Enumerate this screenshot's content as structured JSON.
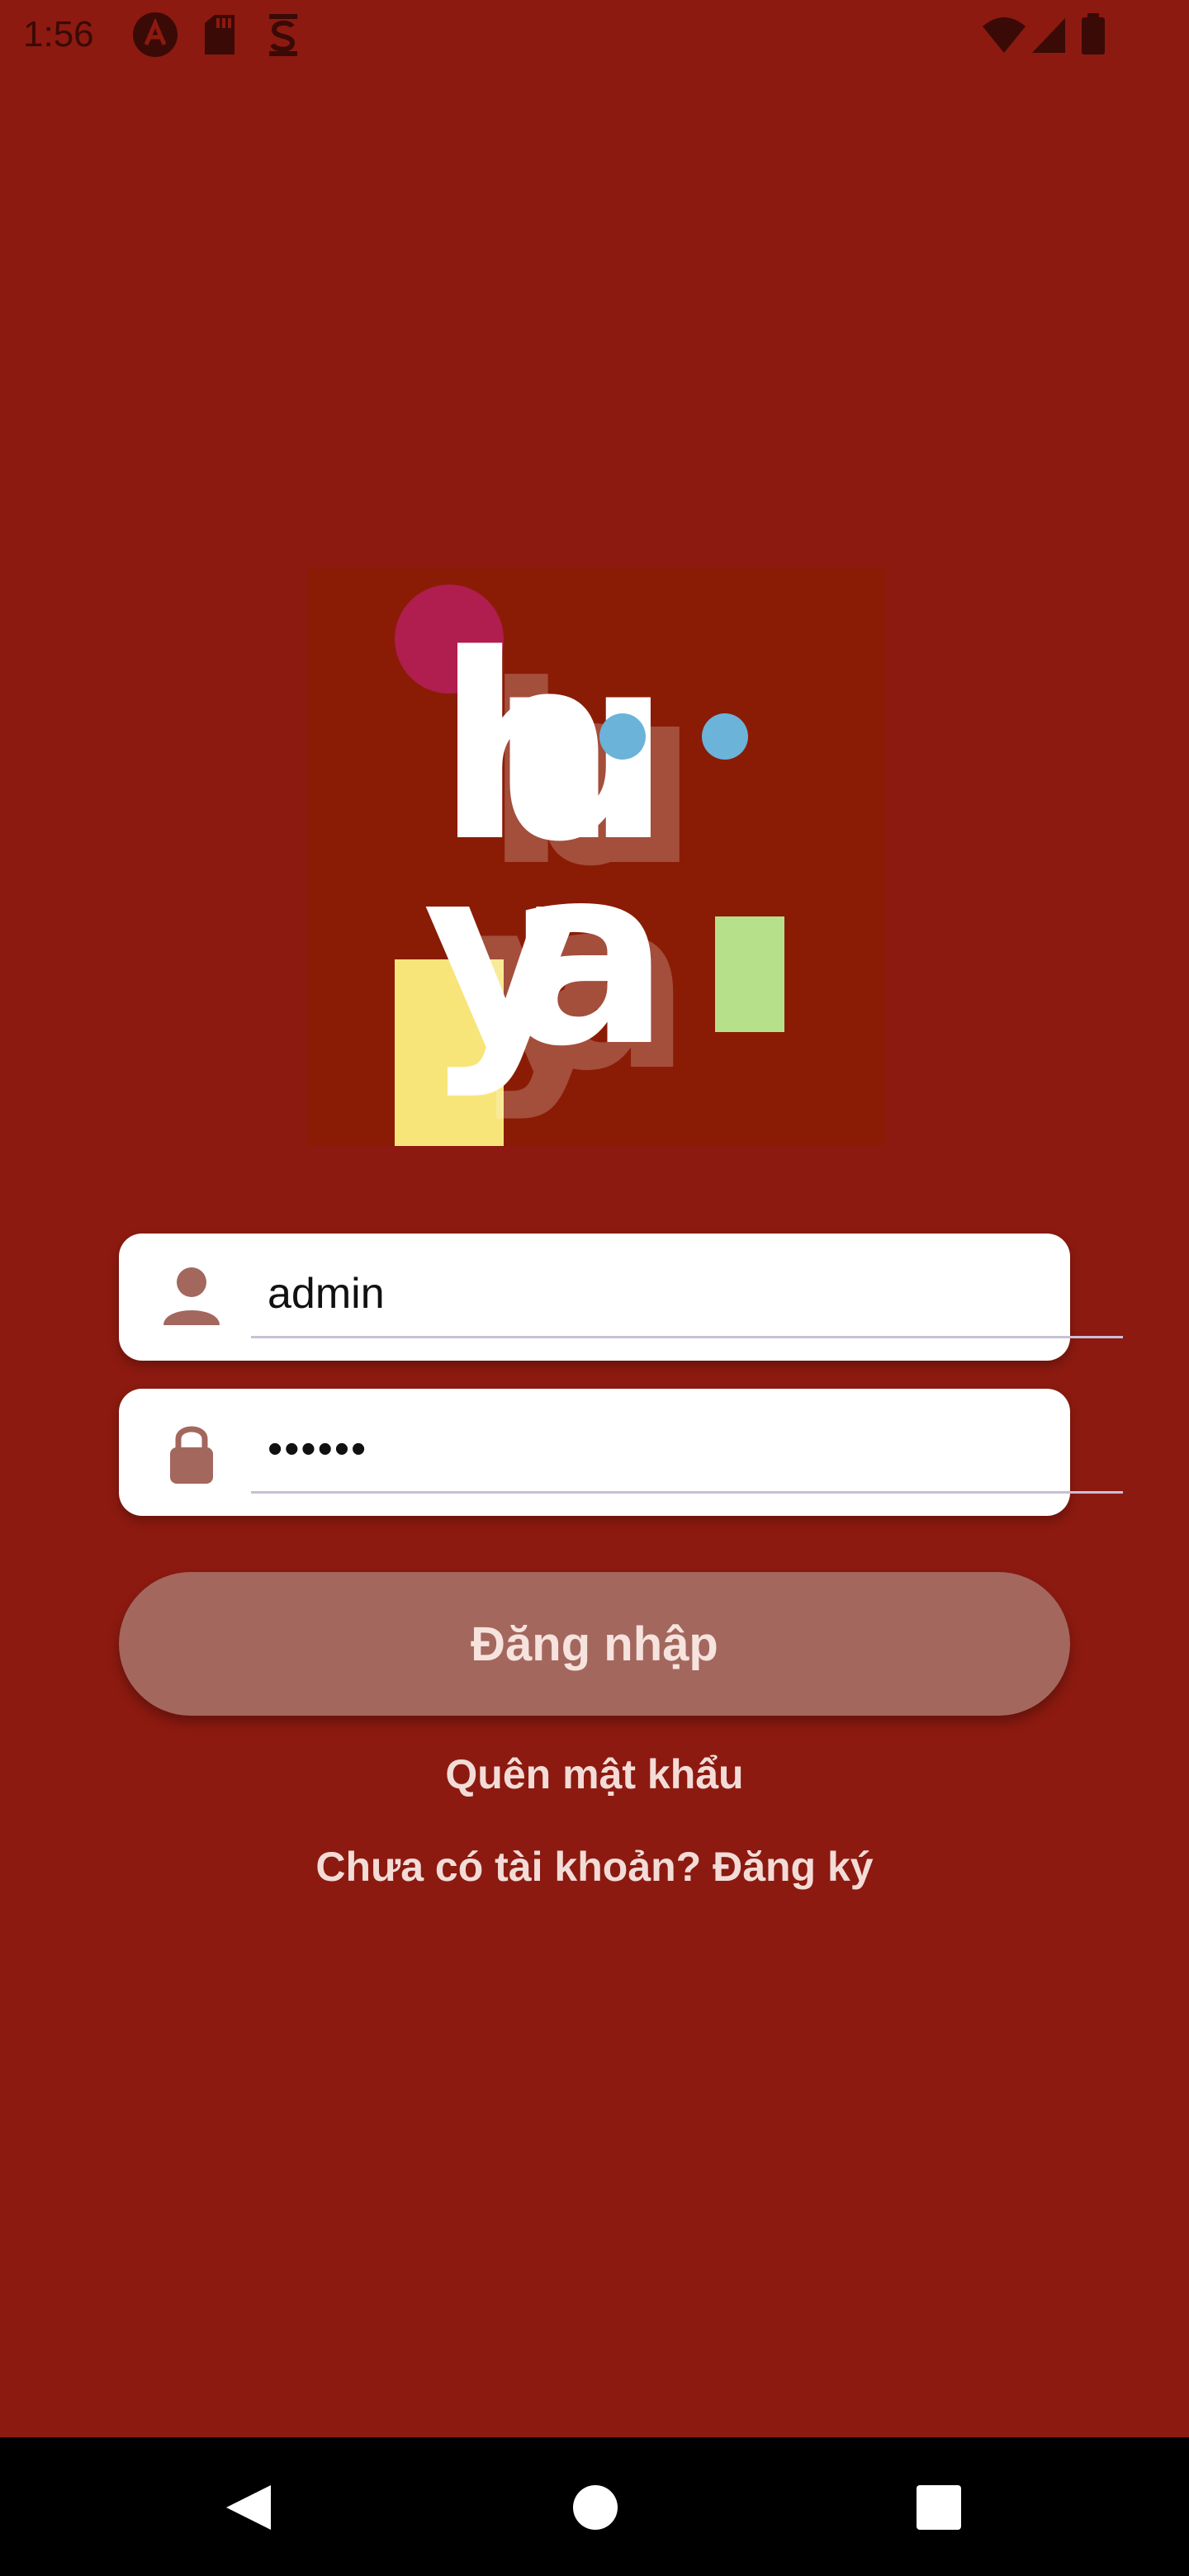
{
  "status_bar": {
    "time": "1:56",
    "icons": [
      "app-a-icon",
      "sd-card-icon",
      "s-icon",
      "wifi-icon",
      "signal-icon",
      "battery-icon"
    ]
  },
  "logo": {
    "text_top": "hu",
    "text_bottom": "ya",
    "colors": {
      "background": "#8a1c05",
      "circle": "#b01d4f",
      "dots": "#6bb3d9",
      "yellow": "#f8e57a",
      "green": "#b6e08a"
    }
  },
  "username": {
    "value": "admin",
    "icon": "person-icon"
  },
  "password": {
    "value": "••••••",
    "icon": "lock-icon"
  },
  "login_button": {
    "label": "Đăng nhập"
  },
  "forgot_password": {
    "label": "Quên mật khẩu"
  },
  "signup": {
    "label": "Chưa có tài khoản? Đăng ký"
  },
  "nav_bar": {
    "icons": [
      "back-icon",
      "home-icon",
      "recents-icon"
    ]
  },
  "colors": {
    "background": "#8c1a10",
    "field_background": "#ffffff",
    "icon_color": "#a3675e",
    "button": "#a3675e",
    "link_text": "#f3dcd7"
  }
}
